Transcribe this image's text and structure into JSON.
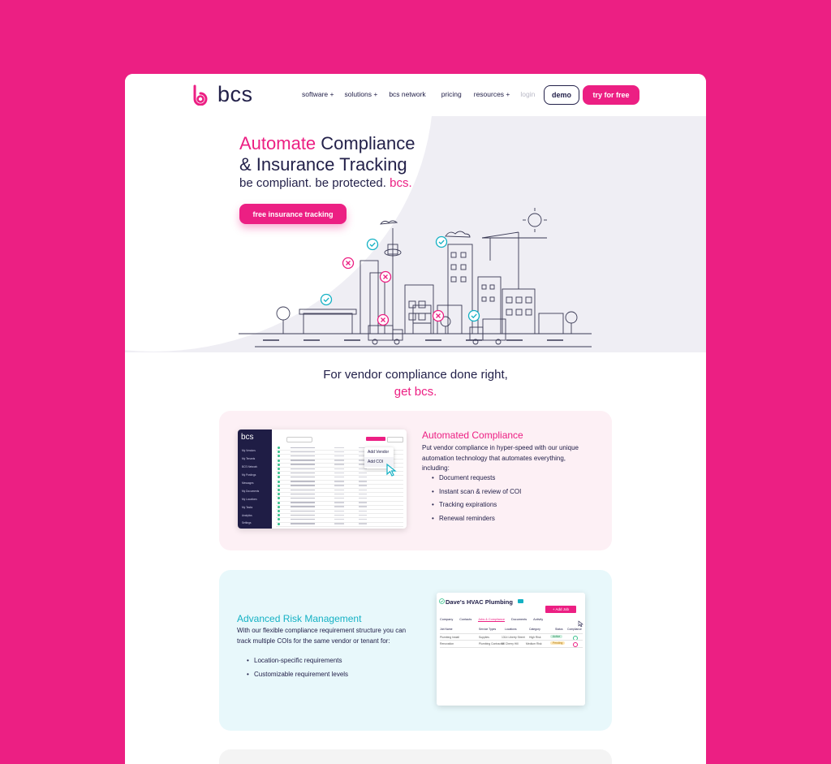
{
  "colors": {
    "brand_pink": "#EC1F83",
    "navy": "#23214A"
  },
  "nav": {
    "logo_text": "bcs",
    "links": [
      "software +",
      "solutions +",
      "bcs network",
      "pricing",
      "resources +",
      "login"
    ],
    "demo": "demo",
    "try_free": "try for free"
  },
  "hero": {
    "title_accent": "Automate",
    "title_rest_1": " Compliance",
    "title_line_2": "& Insurance Tracking",
    "subtitle": "be compliant. be protected. ",
    "subtitle_accent": "bcs.",
    "cta": "free insurance tracking"
  },
  "tagline": {
    "line1": "For vendor compliance done right,",
    "line2": "get bcs."
  },
  "feature1": {
    "title": "Automated Compliance",
    "body": "Put vendor compliance in hyper-speed with our unique automation technology that automates everything, including:",
    "bullets": [
      "Document requests",
      "Instant scan & review of COI",
      "Tracking expirations",
      "Renewal reminders"
    ]
  },
  "mock1": {
    "logo": "bcs",
    "sidebar": [
      "My Vendors",
      "My Tenants",
      "BCS Network",
      "My Postings",
      "Messages",
      "My Documents",
      "My Locations",
      "My Tasks",
      "Analytics",
      "Settings"
    ],
    "dropdown": [
      "Add Vendor",
      "Add COI"
    ]
  },
  "feature2": {
    "title": "Advanced Risk Management",
    "body": "With our flexible compliance requirement structure you can track multiple COIs for the same vendor or tenant for:",
    "bullets": [
      "Location-specific requirements",
      "Customizable requirement levels"
    ]
  },
  "mock2": {
    "title": "Dave's HVAC Plumbing",
    "add_job": "+ Add Job",
    "tabs": [
      "Company",
      "Contacts",
      "Jobs & Compliance",
      "Documents",
      "Activity"
    ],
    "columns": [
      "Job Name",
      "Service Types",
      "Locations",
      "Category",
      "Status",
      "Compliance"
    ],
    "rows": [
      [
        "Plumbing Install",
        "Supplies",
        "1314 Liberty Street",
        "High Risk",
        "Active"
      ],
      [
        "Renovation",
        "Plumbing Contractor",
        "88 Cherry Hill",
        "Medium Risk",
        "Pending"
      ]
    ]
  }
}
